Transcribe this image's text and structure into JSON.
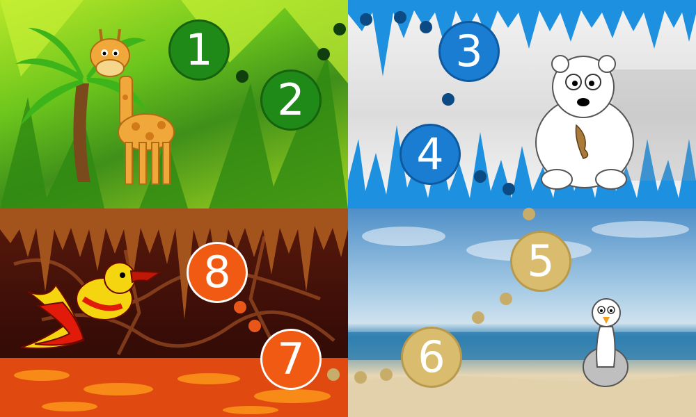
{
  "worlds": [
    {
      "name": "jungle-world",
      "icon": "giraffe-icon"
    },
    {
      "name": "ice-world",
      "icon": "polar-bear-icon"
    },
    {
      "name": "lava-world",
      "icon": "phoenix-bird-icon"
    },
    {
      "name": "beach-world",
      "icon": "seagull-icon"
    }
  ],
  "levels": [
    {
      "label": "1",
      "world": "jungle",
      "color": "#1f8a17"
    },
    {
      "label": "2",
      "world": "jungle",
      "color": "#1f8a17"
    },
    {
      "label": "3",
      "world": "ice",
      "color": "#1a7dd1"
    },
    {
      "label": "4",
      "world": "ice",
      "color": "#1a7dd1"
    },
    {
      "label": "5",
      "world": "beach",
      "color": "#d9bc6d"
    },
    {
      "label": "6",
      "world": "beach",
      "color": "#d9bc6d"
    },
    {
      "label": "7",
      "world": "lava",
      "color": "#f05a12"
    },
    {
      "label": "8",
      "world": "lava",
      "color": "#f05a12"
    }
  ],
  "colors": {
    "jungle_path": "#0f3f0c",
    "ice_path": "#0b4a82",
    "beach_path": "#c8ad6a",
    "lava_path": "#e8561a"
  }
}
